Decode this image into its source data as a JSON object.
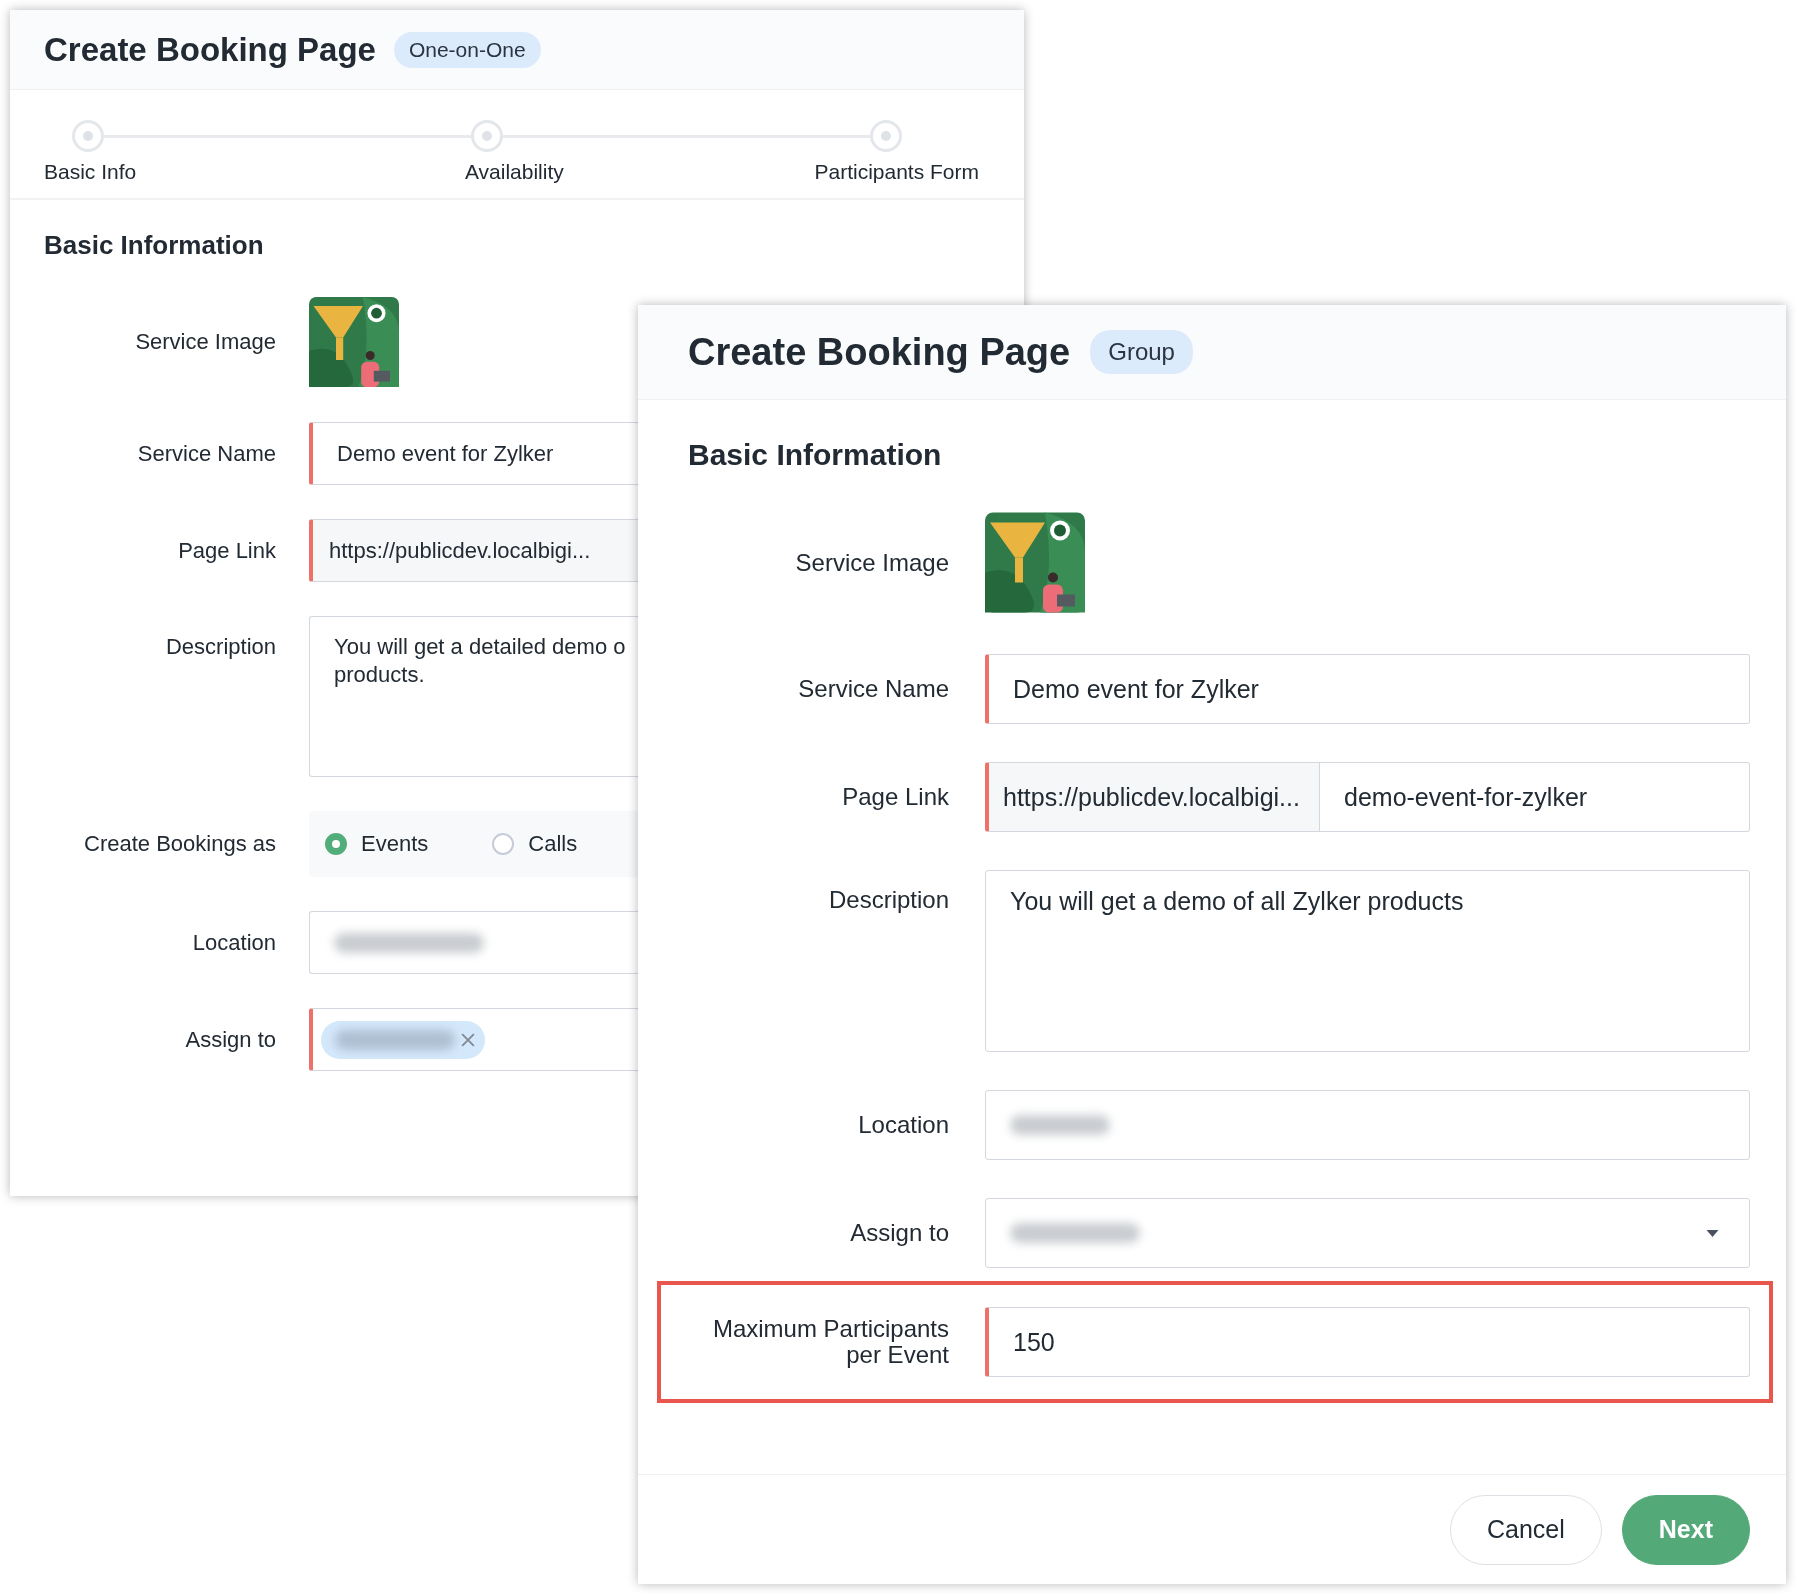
{
  "back_window": {
    "title": "Create Booking Page",
    "badge": "One-on-One",
    "steps": [
      {
        "label": "Basic Info"
      },
      {
        "label": "Availability"
      },
      {
        "label": "Participants Form"
      }
    ],
    "section_title": "Basic Information",
    "fields": [
      {
        "label": "Service Image"
      },
      {
        "label": "Service Name",
        "kind": "text",
        "value": "Demo event for Zylker",
        "required": true
      },
      {
        "label": "Page Link",
        "kind": "link",
        "value": "https://publicdev.localbigi...",
        "required": true
      },
      {
        "label": "Description",
        "kind": "textarea",
        "value": "You will get a detailed demo o\nproducts.",
        "required": false
      },
      {
        "label": "Create Bookings as",
        "kind": "radio",
        "options": [
          {
            "label": "Events",
            "selected": true
          },
          {
            "label": "Calls",
            "selected": false
          }
        ]
      },
      {
        "label": "Location",
        "kind": "blurred",
        "required": false
      },
      {
        "label": "Assign to",
        "kind": "chip",
        "required": true
      }
    ]
  },
  "front_window": {
    "title": "Create Booking Page",
    "badge": "Group",
    "section_title": "Basic Information",
    "fields": [
      {
        "label": "Service Image"
      },
      {
        "label": "Service Name",
        "kind": "text",
        "value": "Demo event for Zylker",
        "required": true,
        "highlighted": false
      },
      {
        "label": "Page Link",
        "kind": "link",
        "prefix": "https://publicdev.localbigi...",
        "value": "demo-event-for-zylker",
        "required": true,
        "highlighted": false
      },
      {
        "label": "Description",
        "kind": "textarea",
        "value": "You will get a demo of all Zylker products",
        "required": false,
        "highlighted": false
      },
      {
        "label": "Location",
        "kind": "blurred",
        "required": false,
        "highlighted": false
      },
      {
        "label": "Assign to",
        "kind": "select",
        "required": false,
        "highlighted": false
      },
      {
        "label": "Maximum Participants\nper Event",
        "kind": "text",
        "value": "150",
        "required": true,
        "highlighted": true
      }
    ],
    "buttons": [
      {
        "label": "Cancel",
        "kind": "secondary"
      },
      {
        "label": "Next",
        "kind": "primary"
      }
    ]
  }
}
